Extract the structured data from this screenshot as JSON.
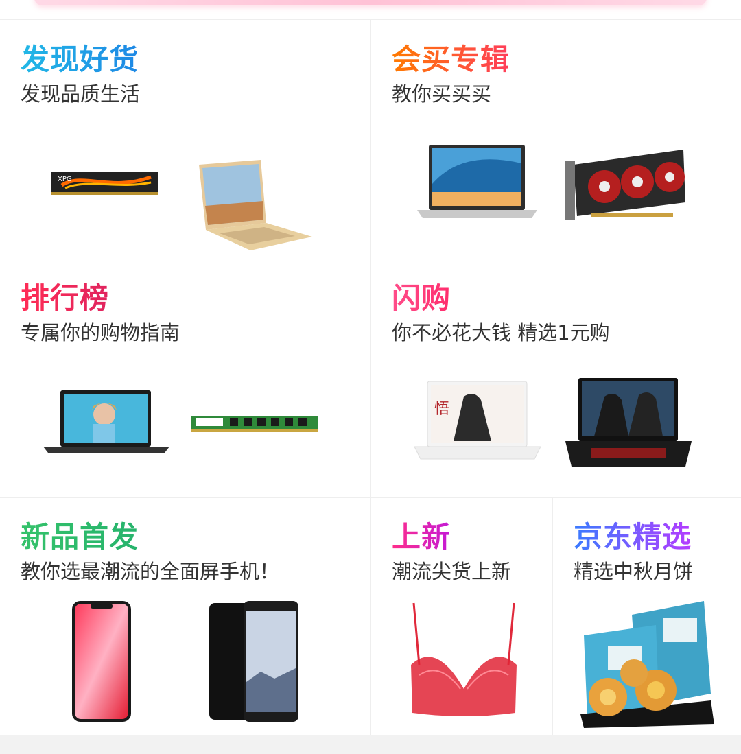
{
  "sections": [
    {
      "title": "发现好货",
      "subtitle": "发现品质生活"
    },
    {
      "title": "会买专辑",
      "subtitle": "教你买买买"
    },
    {
      "title": "排行榜",
      "subtitle": "专属你的购物指南"
    },
    {
      "title": "闪购",
      "subtitle": "你不必花大钱 精选1元购"
    },
    {
      "title": "新品首发",
      "subtitle": "教你选最潮流的全面屏手机！"
    },
    {
      "title": "上新",
      "subtitle": "潮流尖货上新"
    },
    {
      "title": "京东精选",
      "subtitle": "精选中秋月饼"
    }
  ],
  "colors": {
    "cyan_title": "#22b8e6",
    "orange_title": "#ff7a00",
    "red_title": "#ff2d55",
    "pink_title": "#ff4d8a",
    "green_title": "#35c26b",
    "magenta_title": "#ff2e8a",
    "blue_title": "#3a7bff"
  },
  "products": [
    "ram-module-image",
    "laptop-gold-image",
    "laptop-silver-image",
    "graphics-card-image",
    "laptop-black-image",
    "ram-stick-green-image",
    "laptop-white-image",
    "gaming-laptop-image",
    "iphone-x-image",
    "galaxy-note8-image",
    "red-lace-bra-image",
    "mooncake-box-image"
  ]
}
